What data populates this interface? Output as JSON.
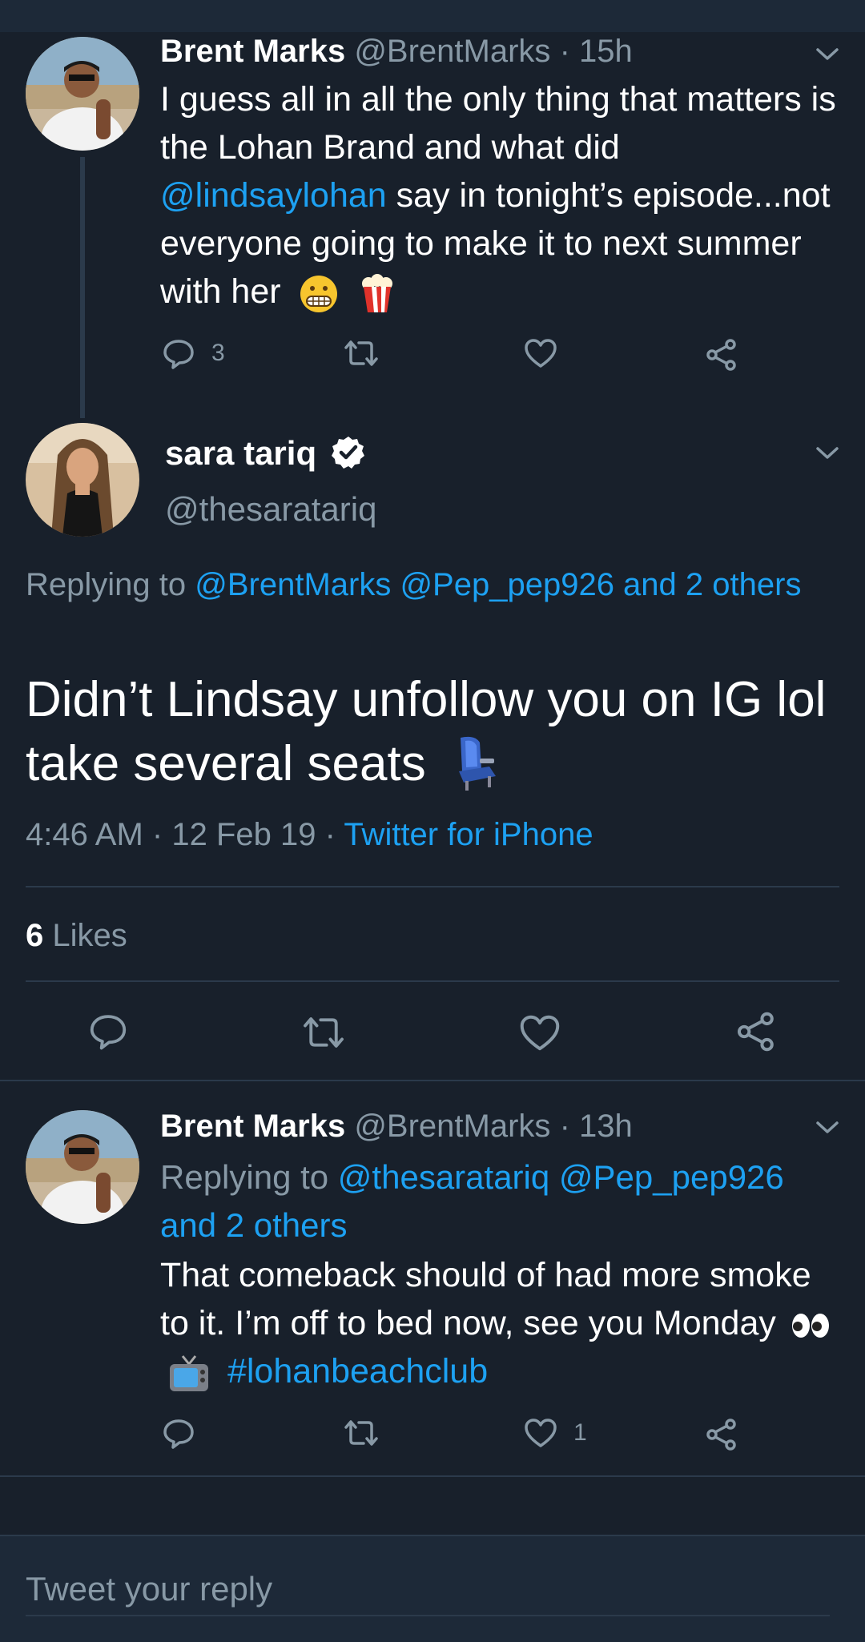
{
  "tweet1": {
    "name": "Brent Marks",
    "handle": "@BrentMarks",
    "sep": "·",
    "time": "15h",
    "text_1": "I guess all in all the only thing that matters is the Lohan Brand and what did ",
    "mention": "@lindsaylohan",
    "text_2": " say in tonight’s episode...not everyone going to make it to next summer with her",
    "reply_count": "3"
  },
  "focus": {
    "name": "sara tariq",
    "handle": "@thesaratariq",
    "replying_prefix": "Replying to ",
    "replying_links": "@BrentMarks @Pep_pep926 and 2 others",
    "text": "Didn’t Lindsay unfollow you on IG lol take several seats",
    "time": "4:46 AM",
    "sep1": "·",
    "date": "12 Feb 19",
    "sep2": "·",
    "source": "Twitter for iPhone",
    "likes_count": "6",
    "likes_label": "Likes"
  },
  "tweet3": {
    "name": "Brent Marks",
    "handle": "@BrentMarks",
    "sep": "·",
    "time": "13h",
    "replying_prefix": "Replying to ",
    "replying_links": "@thesaratariq @Pep_pep926 and 2 others",
    "text": "That comeback should of had more smoke to it. I’m off to bed now, see you Monday",
    "hashtag": "#lohanbeachclub",
    "like_count": "1"
  },
  "composer": {
    "placeholder": "Tweet your reply"
  },
  "colors": {
    "background": "#18202b",
    "link": "#1da1f2",
    "muted": "#8899a6",
    "divider": "#2b3a4b"
  },
  "icons": [
    "reply-icon",
    "retweet-icon",
    "like-icon",
    "share-icon",
    "chevron-down-icon",
    "verified-badge-icon"
  ]
}
